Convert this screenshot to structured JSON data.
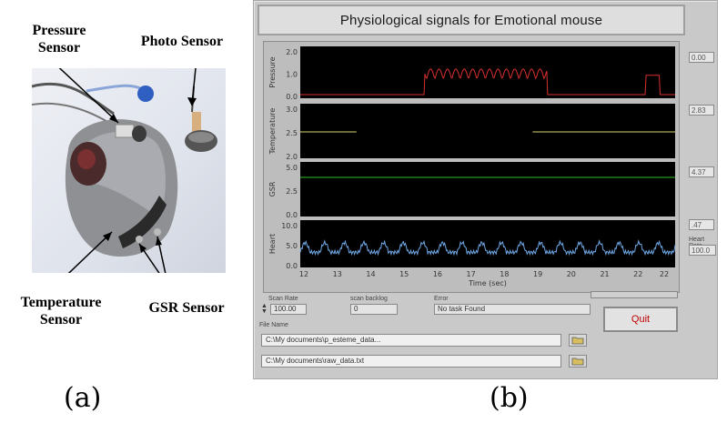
{
  "figure_a": {
    "caption": "(a)",
    "labels": {
      "pressure": "Pressure Sensor",
      "photo": "Photo Sensor",
      "temperature": "Temperature Sensor",
      "gsr": "GSR Sensor"
    }
  },
  "figure_b": {
    "caption": "(b)",
    "title": "Physiological signals for Emotional mouse",
    "channels": [
      {
        "name": "Pressure",
        "color": "#d83030",
        "readout": "0.00",
        "ticks": [
          "2.0",
          "1.0",
          "0.0"
        ]
      },
      {
        "name": "Temperature",
        "color": "#d8d870",
        "readout": "2.83",
        "ticks": [
          "3.0",
          "2.5",
          "2.0"
        ]
      },
      {
        "name": "GSR",
        "color": "#30c030",
        "readout": "4.37",
        "ticks": [
          "5.0",
          "2.5",
          "0.0"
        ]
      },
      {
        "name": "Heart",
        "color": "#6fa8e6",
        "readout": ".47",
        "ticks": [
          "10.0",
          "5.0",
          "0.0"
        ]
      }
    ],
    "x_ticks": [
      "12",
      "13",
      "14",
      "15",
      "16",
      "17",
      "18",
      "19",
      "20",
      "21",
      "22",
      "22"
    ],
    "x_label": "Time (sec)",
    "heart_rate": {
      "label": "Heart Rate",
      "value": "100.0"
    },
    "scan_rate": {
      "label": "Scan Rate",
      "value": "100.00"
    },
    "scan_backlog": {
      "label": "scan backlog",
      "value": "0"
    },
    "error": {
      "label": "Error",
      "value": "No task Found"
    },
    "file_name_label": "File Name",
    "file_path_1": "C:\\My documents\\p_esteme_data...",
    "file_path_2": "C:\\My documents\\raw_data.txt",
    "quit_label": "Quit"
  }
}
